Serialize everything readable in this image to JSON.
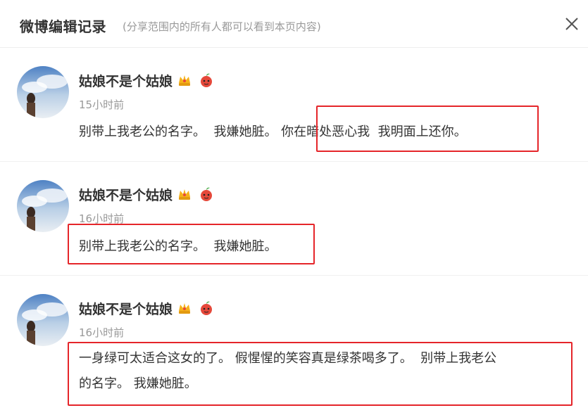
{
  "dialog": {
    "title": "微博编辑记录",
    "subtitle": "(分享范围内的所有人都可以看到本页内容)",
    "close_icon": "close-icon"
  },
  "records": [
    {
      "user_name": "姑娘不是个姑娘",
      "time": "15小时前",
      "content": "别带上我老公的名字。  我嫌她脏。 你在暗处恶心我  我明面上还你。",
      "badges": [
        "crown-badge-icon",
        "apple-mascot-icon"
      ]
    },
    {
      "user_name": "姑娘不是个姑娘",
      "time": "16小时前",
      "content": "别带上我老公的名字。  我嫌她脏。",
      "badges": [
        "crown-badge-icon",
        "apple-mascot-icon"
      ]
    },
    {
      "user_name": "姑娘不是个姑娘",
      "time": "16小时前",
      "content_line1": "一身绿可太适合这女的了。 假惺惺的笑容真是绿茶喝多了。  别带上我老公",
      "content_line2": "的名字。 我嫌她脏。",
      "badges": [
        "crown-badge-icon",
        "apple-mascot-icon"
      ]
    }
  ],
  "colors": {
    "highlight": "#e5252a",
    "secondary_text": "#999999",
    "primary_text": "#333333"
  }
}
